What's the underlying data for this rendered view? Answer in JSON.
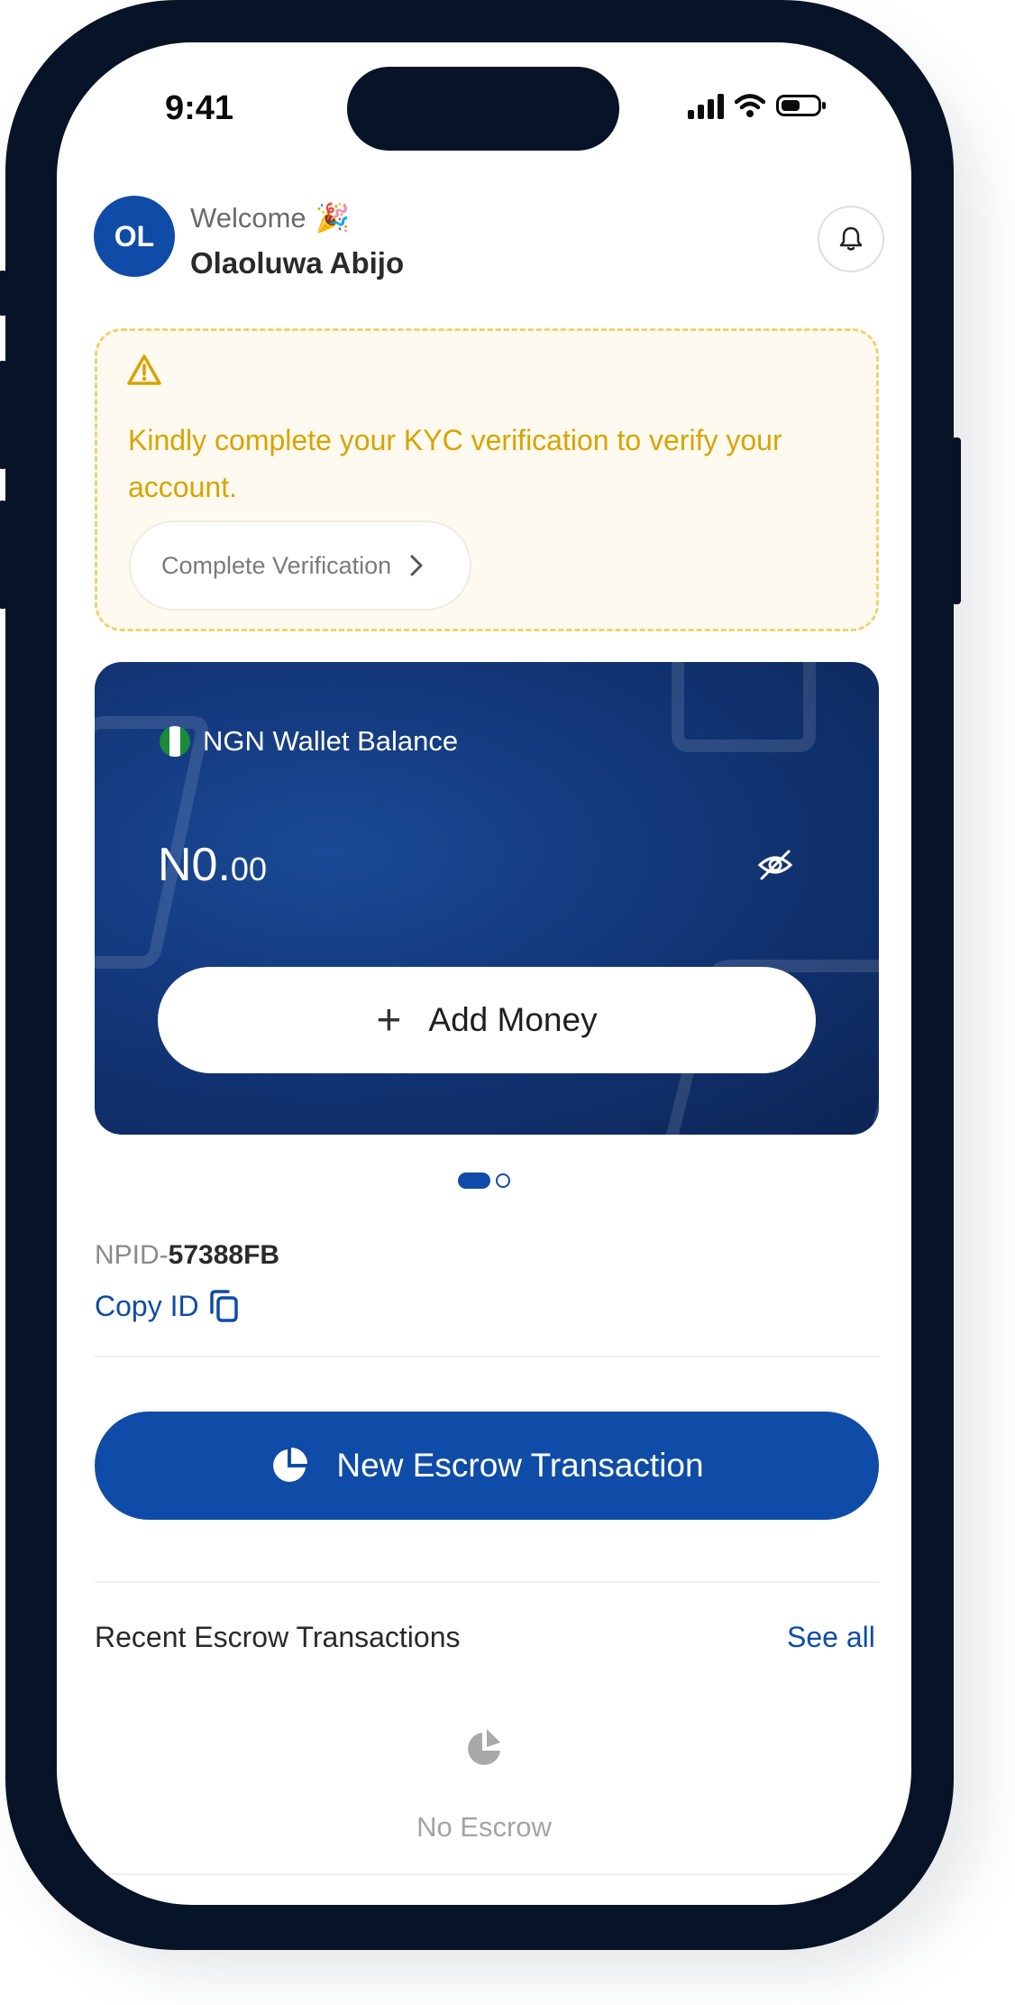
{
  "status_bar": {
    "time": "9:41"
  },
  "header": {
    "avatar_initials": "OL",
    "welcome_text": "Welcome",
    "user_name": "Olaoluwa Abijo"
  },
  "kyc_banner": {
    "message": "Kindly complete your KYC verification to verify your account.",
    "button_label": "Complete Verification"
  },
  "wallet": {
    "title": "NGN Wallet Balance",
    "balance_main": "N0.",
    "balance_decimal": "00",
    "add_money_label": "Add Money"
  },
  "account": {
    "npid_label": "NPID-",
    "npid_value": "57388FB",
    "copy_label": "Copy ID"
  },
  "primary_action": {
    "label": "New Escrow Transaction"
  },
  "recent": {
    "title": "Recent Escrow Transactions",
    "see_all": "See all",
    "empty_text": "No Escrow"
  },
  "colors": {
    "brand_blue": "#0f4ca7",
    "kyc_text": "#d9a300",
    "kyc_background": "#fffaef",
    "phone_frame": "#071427"
  }
}
